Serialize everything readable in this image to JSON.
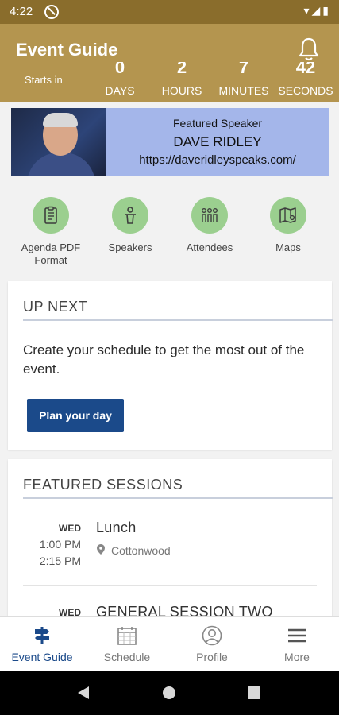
{
  "status": {
    "time": "4:22",
    "icons": "▾◢▮"
  },
  "appbar": {
    "title": "Event Guide",
    "starts_in": "Starts in",
    "countdown": [
      {
        "num": "0",
        "unit": "DAYS"
      },
      {
        "num": "2",
        "unit": "HOURS"
      },
      {
        "num": "7",
        "unit": "MINUTES"
      },
      {
        "num": "42",
        "unit": "SECONDS"
      }
    ]
  },
  "banner": {
    "label": "Featured Speaker",
    "name": "DAVE RIDLEY",
    "url": "https://daveridleyspeaks.com/",
    "bg_color": "#a4b6ea"
  },
  "quick_actions": [
    {
      "label": "Agenda PDF Format",
      "icon": "clipboard-icon"
    },
    {
      "label": "Speakers",
      "icon": "speaker-podium-icon"
    },
    {
      "label": "Attendees",
      "icon": "people-icon"
    },
    {
      "label": "Maps",
      "icon": "map-icon"
    }
  ],
  "up_next": {
    "title": "UP NEXT",
    "text": "Create your schedule to get the most out of the event.",
    "button": "Plan your day"
  },
  "featured": {
    "title": "FEATURED SESSIONS",
    "sessions": [
      {
        "day": "WED",
        "start": "1:00 PM",
        "end": "2:15 PM",
        "title": "Lunch",
        "location": "Cottonwood"
      },
      {
        "day": "WED",
        "title": "GENERAL SESSION TWO"
      }
    ]
  },
  "tabs": [
    {
      "label": "Event Guide",
      "icon": "signpost-icon",
      "active": true
    },
    {
      "label": "Schedule",
      "icon": "calendar-icon"
    },
    {
      "label": "Profile",
      "icon": "profile-icon"
    },
    {
      "label": "More",
      "icon": "hamburger-menu-icon"
    }
  ],
  "colors": {
    "header": "#b4954f",
    "status_bar": "#8a6d2c",
    "accent": "#1b4a8a",
    "icon_circle": "#9bcf8f"
  }
}
